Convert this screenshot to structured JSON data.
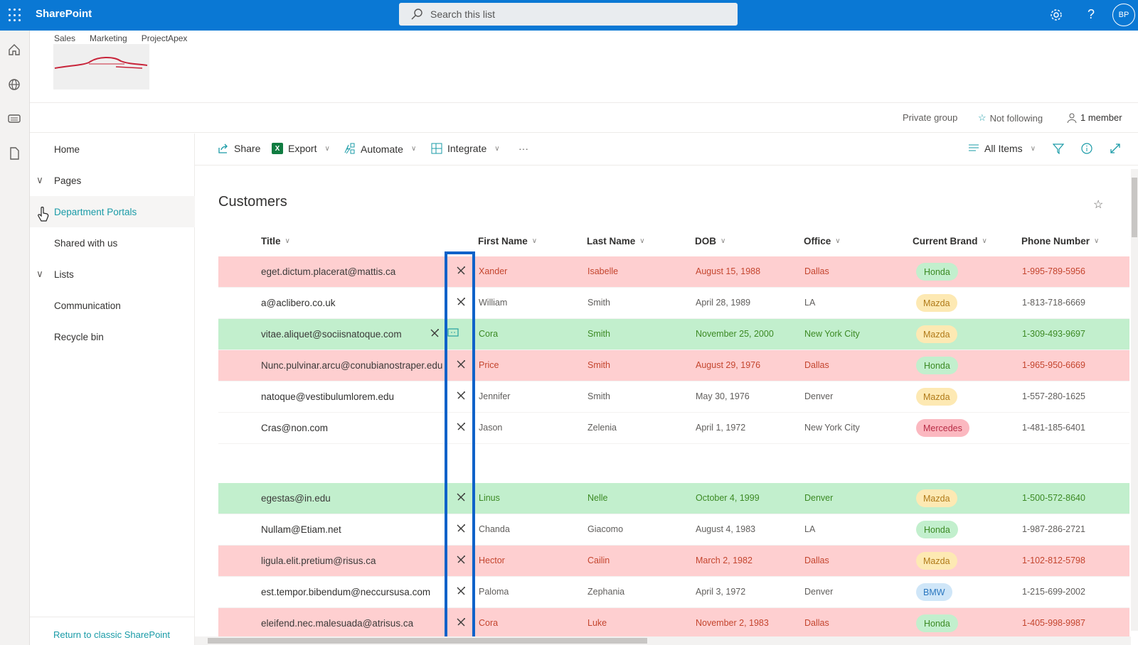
{
  "suitebar": {
    "app_name": "SharePoint",
    "search_placeholder": "Search this list",
    "avatar_initials": "BP",
    "icons": [
      "waffle-icon",
      "search-icon",
      "settings-icon",
      "help-icon"
    ]
  },
  "rail": {
    "icons": [
      "home-icon",
      "globe-icon",
      "news-icon",
      "document-icon"
    ]
  },
  "hub_nav": [
    "Sales",
    "Marketing",
    "ProjectApex"
  ],
  "group_bar": {
    "privacy": "Private group",
    "follow": "Not following",
    "members": "1 member"
  },
  "left_nav": {
    "items": [
      {
        "label": "Home",
        "expandable": false,
        "selected": false
      },
      {
        "label": "Pages",
        "expandable": true,
        "selected": false
      },
      {
        "label": "Department Portals",
        "expandable": true,
        "selected": true
      },
      {
        "label": "Shared with us",
        "expandable": false,
        "selected": false
      },
      {
        "label": "Lists",
        "expandable": true,
        "selected": false
      },
      {
        "label": "Communication",
        "expandable": false,
        "selected": false
      },
      {
        "label": "Recycle bin",
        "expandable": false,
        "selected": false
      }
    ],
    "return_link": "Return to classic SharePoint"
  },
  "command_bar": {
    "share": "Share",
    "export": "Export",
    "automate": "Automate",
    "integrate": "Integrate",
    "more": "···",
    "view": "All Items"
  },
  "list": {
    "title": "Customers",
    "columns": [
      "Title",
      "First Name",
      "Last Name",
      "DOB",
      "Office",
      "Current Brand",
      "Phone Number"
    ],
    "rows": [
      {
        "style": "red",
        "title": "eget.dictum.placerat@mattis.ca",
        "first": "Xander",
        "last": "Isabelle",
        "dob": "August 15, 1988",
        "office": "Dallas",
        "brand": "Honda",
        "phone": "1-995-789-5956"
      },
      {
        "style": "plain",
        "title": "a@aclibero.co.uk",
        "first": "William",
        "last": "Smith",
        "dob": "April 28, 1989",
        "office": "LA",
        "brand": "Mazda",
        "phone": "1-813-718-6669"
      },
      {
        "style": "green",
        "title": "vitae.aliquet@sociisnatoque.com",
        "first": "Cora",
        "last": "Smith",
        "dob": "November 25, 2000",
        "office": "New York City",
        "brand": "Mazda",
        "phone": "1-309-493-9697"
      },
      {
        "style": "red",
        "title": "Nunc.pulvinar.arcu@conubianostraper.edu",
        "first": "Price",
        "last": "Smith",
        "dob": "August 29, 1976",
        "office": "Dallas",
        "brand": "Honda",
        "phone": "1-965-950-6669"
      },
      {
        "style": "plain",
        "title": "natoque@vestibulumlorem.edu",
        "first": "Jennifer",
        "last": "Smith",
        "dob": "May 30, 1976",
        "office": "Denver",
        "brand": "Mazda",
        "phone": "1-557-280-1625"
      },
      {
        "style": "plain",
        "title": "Cras@non.com",
        "first": "Jason",
        "last": "Zelenia",
        "dob": "April 1, 1972",
        "office": "New York City",
        "brand": "Mercedes",
        "phone": "1-481-185-6401"
      },
      {
        "style": "green",
        "title": "egestas@in.edu",
        "first": "Linus",
        "last": "Nelle",
        "dob": "October 4, 1999",
        "office": "Denver",
        "brand": "Mazda",
        "phone": "1-500-572-8640"
      },
      {
        "style": "plain",
        "title": "Nullam@Etiam.net",
        "first": "Chanda",
        "last": "Giacomo",
        "dob": "August 4, 1983",
        "office": "LA",
        "brand": "Honda",
        "phone": "1-987-286-2721"
      },
      {
        "style": "red",
        "title": "ligula.elit.pretium@risus.ca",
        "first": "Hector",
        "last": "Cailin",
        "dob": "March 2, 1982",
        "office": "Dallas",
        "brand": "Mazda",
        "phone": "1-102-812-5798"
      },
      {
        "style": "plain",
        "title": "est.tempor.bibendum@neccursusa.com",
        "first": "Paloma",
        "last": "Zephania",
        "dob": "April 3, 1972",
        "office": "Denver",
        "brand": "BMW",
        "phone": "1-215-699-2002"
      },
      {
        "style": "red",
        "title": "eleifend.nec.malesuada@atrisus.ca",
        "first": "Cora",
        "last": "Luke",
        "dob": "November 2, 1983",
        "office": "Dallas",
        "brand": "Honda",
        "phone": "1-405-998-9987"
      }
    ]
  },
  "colors": {
    "suitebar": "#0a78d4",
    "accent": "#1a9ba7",
    "row_red": "#fecfd0",
    "row_green": "#c2efcd",
    "highlight_box": "#0f62c9"
  }
}
